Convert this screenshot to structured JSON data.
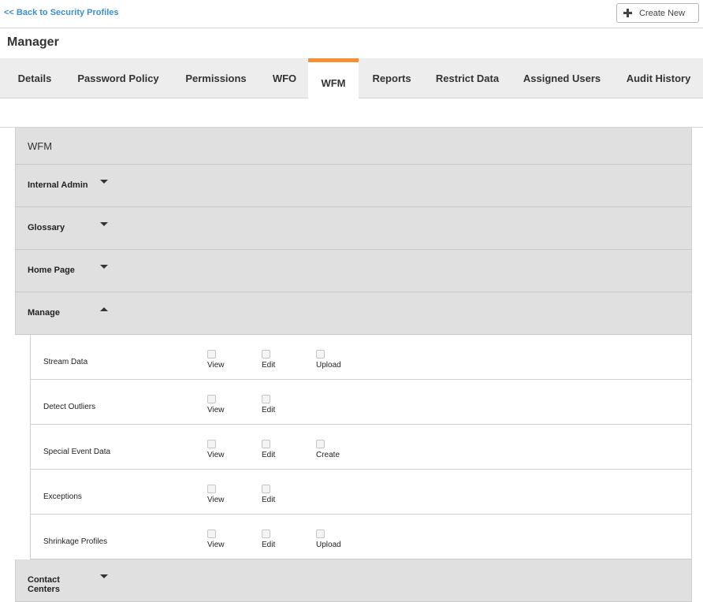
{
  "back_link": "<< Back to Security Profiles",
  "create_button": "Create New",
  "page_title": "Manager",
  "tabs": [
    {
      "label": "Details"
    },
    {
      "label": "Password Policy"
    },
    {
      "label": "Permissions"
    },
    {
      "label": "WFO"
    },
    {
      "label": "WFM",
      "active": true
    },
    {
      "label": "Reports"
    },
    {
      "label": "Restrict Data"
    },
    {
      "label": "Assigned Users"
    },
    {
      "label": "Audit History"
    }
  ],
  "colors": {
    "active_tab_accent": "#f78f33",
    "link": "#3b8fd3",
    "section_bg": "#e0e0e0"
  },
  "panel": {
    "title": "WFM",
    "sections": [
      {
        "label": "Internal Admin",
        "expanded": false
      },
      {
        "label": "Glossary",
        "expanded": false
      },
      {
        "label": "Home Page",
        "expanded": false
      },
      {
        "label": "Manage",
        "expanded": true
      },
      {
        "label": "Contact Centers",
        "expanded": false
      }
    ],
    "manage_items": [
      {
        "name": "Stream Data",
        "options": [
          "View",
          "Edit",
          "Upload"
        ]
      },
      {
        "name": "Detect Outliers",
        "options": [
          "View",
          "Edit"
        ]
      },
      {
        "name": "Special Event Data",
        "options": [
          "View",
          "Edit",
          "Create"
        ]
      },
      {
        "name": "Exceptions",
        "options": [
          "View",
          "Edit"
        ]
      },
      {
        "name": "Shrinkage Profiles",
        "options": [
          "View",
          "Edit",
          "Upload"
        ]
      }
    ]
  }
}
